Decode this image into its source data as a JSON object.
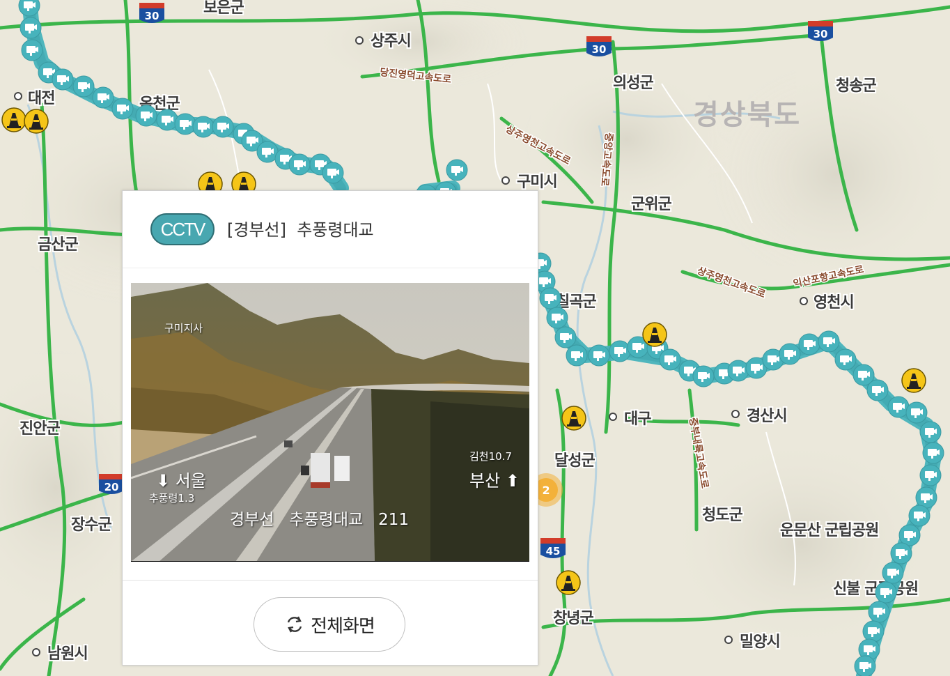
{
  "map": {
    "region_label": "경상북도",
    "places": [
      "보은군",
      "상주시",
      "대전",
      "옥천군",
      "의성군",
      "청송군",
      "구미시",
      "군위군",
      "금산군",
      "영천시",
      "칠곡군",
      "대구",
      "경산시",
      "진안군",
      "달성군",
      "장수군",
      "청도군",
      "운문산 군립공원",
      "창녕군",
      "신불 군립공원",
      "밀양시",
      "남원시"
    ],
    "road_labels": [
      "당진영덕고속도로",
      "상주영천고속도로",
      "중앙고속도로",
      "익산포항고속도로",
      "중부내륙고속도로"
    ],
    "route_shields": [
      "30",
      "30",
      "30",
      "20",
      "45"
    ],
    "cluster_count": "2",
    "colors": {
      "highway": "#2db34a",
      "cctv_marker": "#47b3bc",
      "route_shield_blue": "#1a4fa0",
      "route_shield_red": "#d23c2a",
      "cluster": "#f3b13a"
    }
  },
  "popup": {
    "badge": "CCTV",
    "title": "[경부선]  추풍령대교",
    "image": {
      "overlay_top": "구미지사",
      "dir_left": "서울",
      "dir_left_sub": "추풍령1.3",
      "dir_right_sub": "김천10.7",
      "dir_right": "부산",
      "caption_route": "경부선",
      "caption_name": "추풍령대교",
      "caption_km": "211"
    },
    "fullscreen_label": "전체화면",
    "icons": {
      "badge": "cctv-badge",
      "fullscreen": "refresh-icon"
    }
  }
}
